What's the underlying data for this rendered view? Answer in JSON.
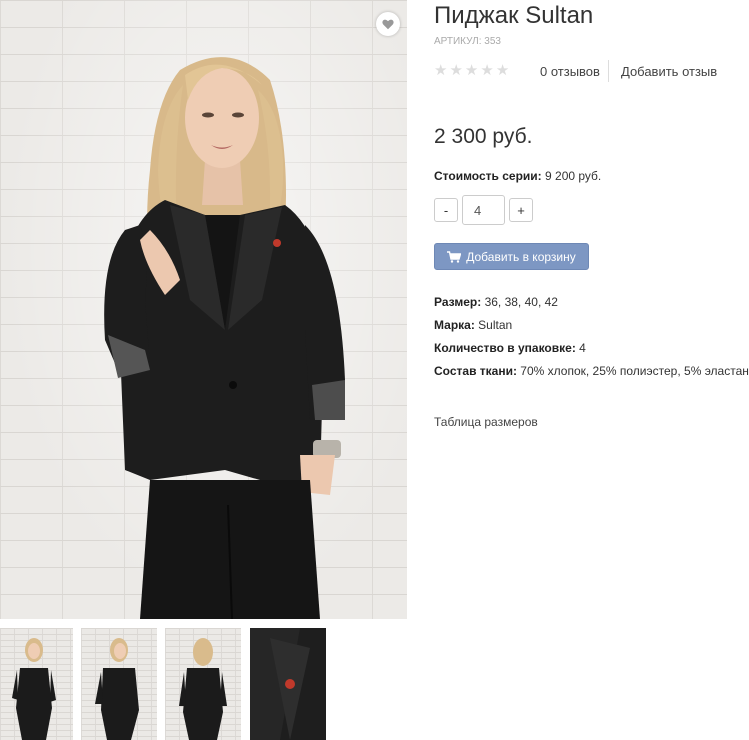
{
  "product": {
    "title": "Пиджак Sultan",
    "sku": "АРТИКУЛ: 353",
    "rating_stars": 0,
    "reviews_count": "0 отзывов",
    "add_review": "Добавить отзыв",
    "price": "2 300 руб.",
    "series_cost_label": "Стоимость серии:",
    "series_cost_value": "9 200 руб.",
    "quantity": "4",
    "qty_minus": "-",
    "qty_plus": "+",
    "add_to_cart": "Добавить в корзину",
    "specs": {
      "size_label": "Размер:",
      "size_value": "36, 38, 40, 42",
      "brand_label": "Марка:",
      "brand_value": "Sultan",
      "pack_label": "Количество в упаковке:",
      "pack_value": "4",
      "fabric_label": "Состав ткани:",
      "fabric_value": "70% хлопок, 25% полиэстер, 5% эластан"
    },
    "size_table_link": "Таблица размеров"
  },
  "icons": {
    "favorite": "heart-icon",
    "cart": "cart-icon",
    "star": "star-icon"
  },
  "colors": {
    "cart_button": "#7d97c3",
    "star_empty": "#dddddd",
    "sku_text": "#aaaaaa"
  }
}
